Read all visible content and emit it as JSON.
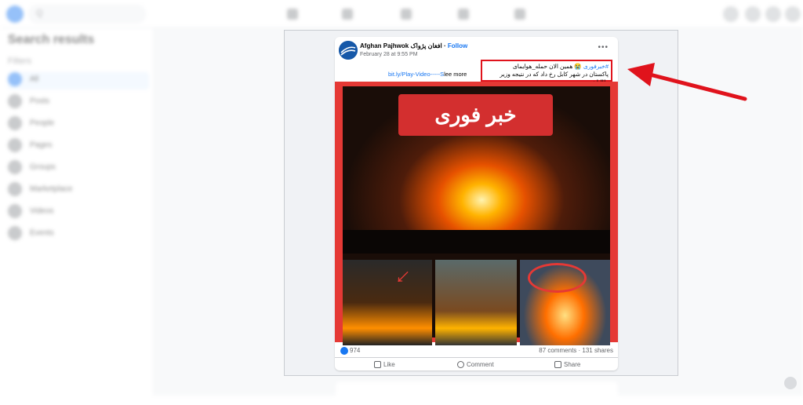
{
  "post": {
    "page_name": "Afghan Pajhwok افغان پژواک",
    "follow_label": "Follow",
    "date": "February 28 at 9:55 PM",
    "more_label": "•••",
    "hashtag": "#خبرفوری",
    "text_line1": "😭 همین الان حمله_هوایمای",
    "text_line2": "پاکستان در شهر کابل رخ داد که در نتیجه وزیر طالبان",
    "link": "bit.ly/Play-Video-----S",
    "see_more": "lee more",
    "image_headline": "خبر فوری",
    "reaction_count": "974",
    "comments": "87 comments",
    "shares": "131 shares",
    "actions": [
      "Like",
      "Comment",
      "Share"
    ]
  },
  "sidebar": {
    "title": "Search results",
    "filters_label": "Filters",
    "items": [
      "All",
      "Posts",
      "People",
      "Pages",
      "Groups",
      "Marketplace",
      "Videos",
      "Events"
    ]
  },
  "search": {
    "placeholder": "Q",
    "text": ""
  },
  "colors": {
    "brand": "#1877f2",
    "highlight": "#e0131c",
    "image_border": "#e53935"
  }
}
